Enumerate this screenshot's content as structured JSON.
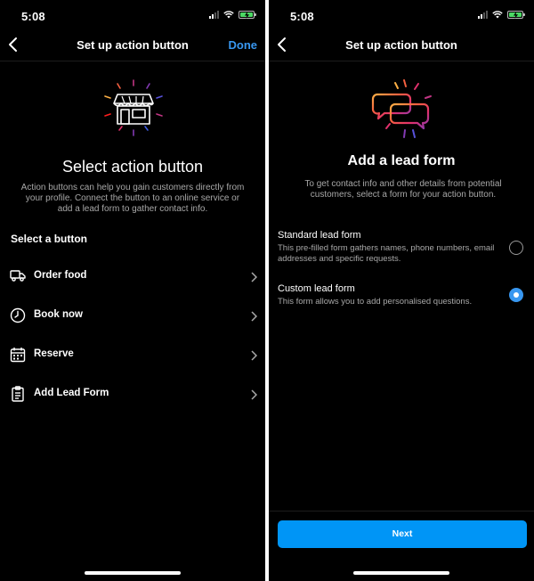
{
  "left": {
    "status": {
      "time": "5:08"
    },
    "nav": {
      "title": "Set up action button",
      "done_label": "Done"
    },
    "heading": "Select action button",
    "description": "Action buttons can help you gain customers directly from your profile. Connect the button to an online service or add a lead form to gather contact info.",
    "section_label": "Select a button",
    "options": [
      {
        "label": "Order food",
        "icon": "delivery-truck-icon"
      },
      {
        "label": "Book now",
        "icon": "clock-icon"
      },
      {
        "label": "Reserve",
        "icon": "calendar-icon"
      },
      {
        "label": "Add Lead Form",
        "icon": "clipboard-icon"
      }
    ]
  },
  "right": {
    "status": {
      "time": "5:08"
    },
    "nav": {
      "title": "Set up action button"
    },
    "heading": "Add a lead form",
    "description": "To get contact info and other details from potential customers, select a form for your action button.",
    "forms": [
      {
        "title": "Standard lead form",
        "description": "This pre-filled form gathers names, phone numbers, email addresses and specific requests.",
        "selected": false
      },
      {
        "title": "Custom lead form",
        "description": "This form allows you to add personalised questions.",
        "selected": true
      }
    ],
    "next_label": "Next"
  },
  "colors": {
    "accent": "#0095f6",
    "link": "#3897f0",
    "battery": "#4cd964",
    "background": "#000000"
  }
}
